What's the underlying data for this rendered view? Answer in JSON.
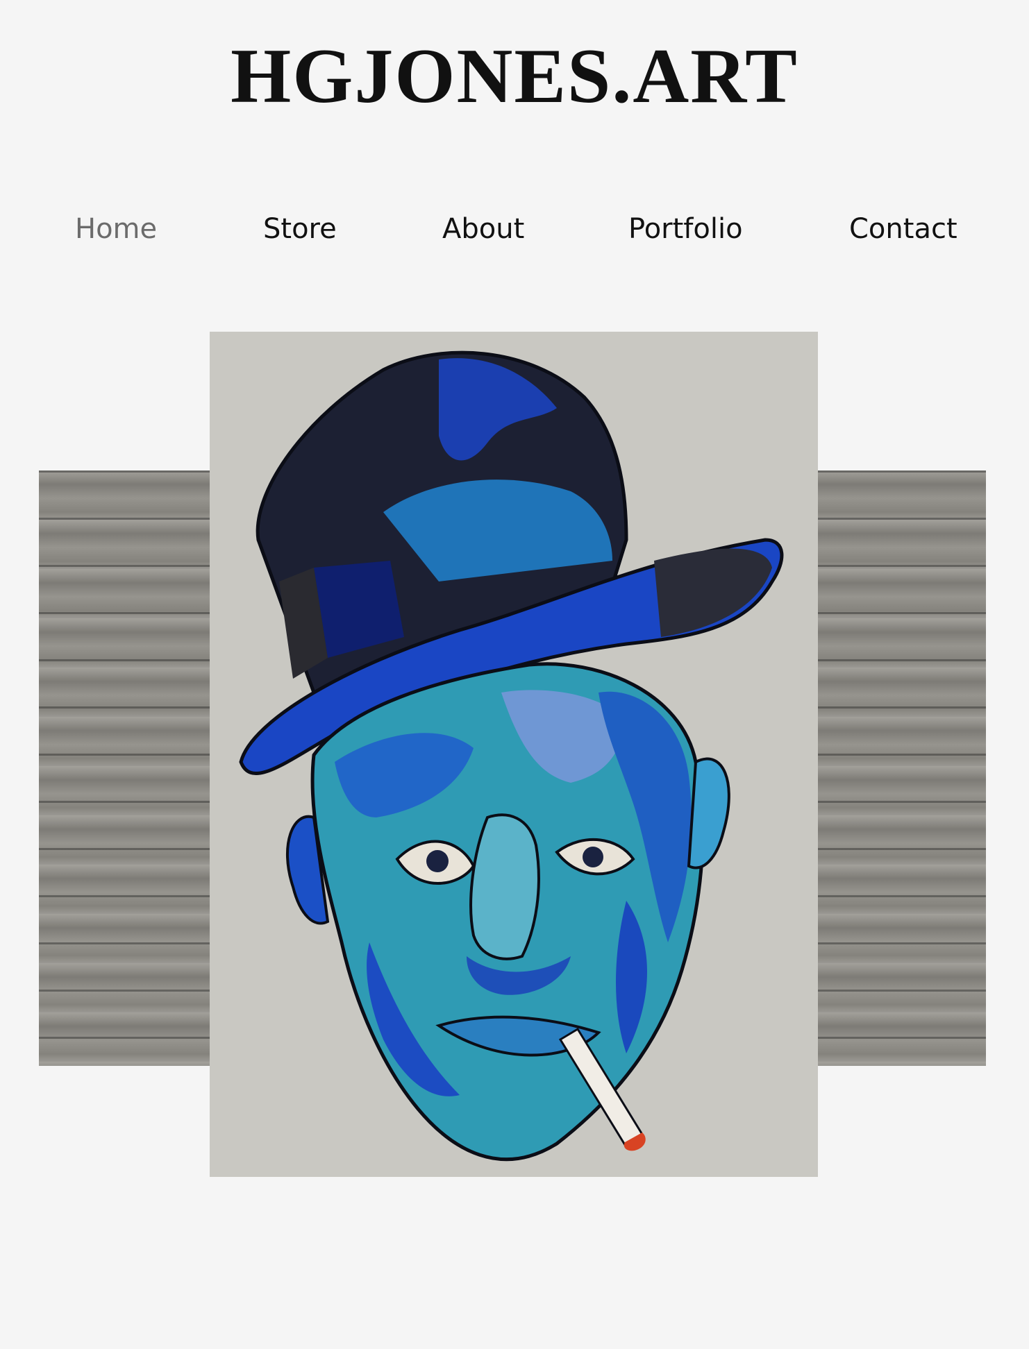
{
  "header": {
    "site_title": "HGJONES.ART"
  },
  "nav": {
    "items": [
      {
        "label": "Home",
        "active": true
      },
      {
        "label": "Store",
        "active": false
      },
      {
        "label": "About",
        "active": false
      },
      {
        "label": "Portfolio",
        "active": false
      },
      {
        "label": "Contact",
        "active": false
      }
    ]
  },
  "colors": {
    "background": "#f5f5f5",
    "text": "#111111",
    "nav_active": "#6b6b6b",
    "art_background": "#c9c8c2"
  }
}
